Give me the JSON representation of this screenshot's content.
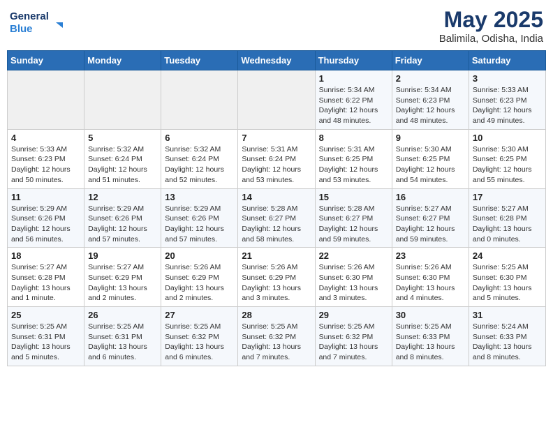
{
  "header": {
    "logo_line1": "General",
    "logo_line2": "Blue",
    "month_title": "May 2025",
    "location": "Balimila, Odisha, India"
  },
  "weekdays": [
    "Sunday",
    "Monday",
    "Tuesday",
    "Wednesday",
    "Thursday",
    "Friday",
    "Saturday"
  ],
  "weeks": [
    [
      {
        "day": "",
        "info": ""
      },
      {
        "day": "",
        "info": ""
      },
      {
        "day": "",
        "info": ""
      },
      {
        "day": "",
        "info": ""
      },
      {
        "day": "1",
        "info": "Sunrise: 5:34 AM\nSunset: 6:22 PM\nDaylight: 12 hours\nand 48 minutes."
      },
      {
        "day": "2",
        "info": "Sunrise: 5:34 AM\nSunset: 6:23 PM\nDaylight: 12 hours\nand 48 minutes."
      },
      {
        "day": "3",
        "info": "Sunrise: 5:33 AM\nSunset: 6:23 PM\nDaylight: 12 hours\nand 49 minutes."
      }
    ],
    [
      {
        "day": "4",
        "info": "Sunrise: 5:33 AM\nSunset: 6:23 PM\nDaylight: 12 hours\nand 50 minutes."
      },
      {
        "day": "5",
        "info": "Sunrise: 5:32 AM\nSunset: 6:24 PM\nDaylight: 12 hours\nand 51 minutes."
      },
      {
        "day": "6",
        "info": "Sunrise: 5:32 AM\nSunset: 6:24 PM\nDaylight: 12 hours\nand 52 minutes."
      },
      {
        "day": "7",
        "info": "Sunrise: 5:31 AM\nSunset: 6:24 PM\nDaylight: 12 hours\nand 53 minutes."
      },
      {
        "day": "8",
        "info": "Sunrise: 5:31 AM\nSunset: 6:25 PM\nDaylight: 12 hours\nand 53 minutes."
      },
      {
        "day": "9",
        "info": "Sunrise: 5:30 AM\nSunset: 6:25 PM\nDaylight: 12 hours\nand 54 minutes."
      },
      {
        "day": "10",
        "info": "Sunrise: 5:30 AM\nSunset: 6:25 PM\nDaylight: 12 hours\nand 55 minutes."
      }
    ],
    [
      {
        "day": "11",
        "info": "Sunrise: 5:29 AM\nSunset: 6:26 PM\nDaylight: 12 hours\nand 56 minutes."
      },
      {
        "day": "12",
        "info": "Sunrise: 5:29 AM\nSunset: 6:26 PM\nDaylight: 12 hours\nand 57 minutes."
      },
      {
        "day": "13",
        "info": "Sunrise: 5:29 AM\nSunset: 6:26 PM\nDaylight: 12 hours\nand 57 minutes."
      },
      {
        "day": "14",
        "info": "Sunrise: 5:28 AM\nSunset: 6:27 PM\nDaylight: 12 hours\nand 58 minutes."
      },
      {
        "day": "15",
        "info": "Sunrise: 5:28 AM\nSunset: 6:27 PM\nDaylight: 12 hours\nand 59 minutes."
      },
      {
        "day": "16",
        "info": "Sunrise: 5:27 AM\nSunset: 6:27 PM\nDaylight: 12 hours\nand 59 minutes."
      },
      {
        "day": "17",
        "info": "Sunrise: 5:27 AM\nSunset: 6:28 PM\nDaylight: 13 hours\nand 0 minutes."
      }
    ],
    [
      {
        "day": "18",
        "info": "Sunrise: 5:27 AM\nSunset: 6:28 PM\nDaylight: 13 hours\nand 1 minute."
      },
      {
        "day": "19",
        "info": "Sunrise: 5:27 AM\nSunset: 6:29 PM\nDaylight: 13 hours\nand 2 minutes."
      },
      {
        "day": "20",
        "info": "Sunrise: 5:26 AM\nSunset: 6:29 PM\nDaylight: 13 hours\nand 2 minutes."
      },
      {
        "day": "21",
        "info": "Sunrise: 5:26 AM\nSunset: 6:29 PM\nDaylight: 13 hours\nand 3 minutes."
      },
      {
        "day": "22",
        "info": "Sunrise: 5:26 AM\nSunset: 6:30 PM\nDaylight: 13 hours\nand 3 minutes."
      },
      {
        "day": "23",
        "info": "Sunrise: 5:26 AM\nSunset: 6:30 PM\nDaylight: 13 hours\nand 4 minutes."
      },
      {
        "day": "24",
        "info": "Sunrise: 5:25 AM\nSunset: 6:30 PM\nDaylight: 13 hours\nand 5 minutes."
      }
    ],
    [
      {
        "day": "25",
        "info": "Sunrise: 5:25 AM\nSunset: 6:31 PM\nDaylight: 13 hours\nand 5 minutes."
      },
      {
        "day": "26",
        "info": "Sunrise: 5:25 AM\nSunset: 6:31 PM\nDaylight: 13 hours\nand 6 minutes."
      },
      {
        "day": "27",
        "info": "Sunrise: 5:25 AM\nSunset: 6:32 PM\nDaylight: 13 hours\nand 6 minutes."
      },
      {
        "day": "28",
        "info": "Sunrise: 5:25 AM\nSunset: 6:32 PM\nDaylight: 13 hours\nand 7 minutes."
      },
      {
        "day": "29",
        "info": "Sunrise: 5:25 AM\nSunset: 6:32 PM\nDaylight: 13 hours\nand 7 minutes."
      },
      {
        "day": "30",
        "info": "Sunrise: 5:25 AM\nSunset: 6:33 PM\nDaylight: 13 hours\nand 8 minutes."
      },
      {
        "day": "31",
        "info": "Sunrise: 5:24 AM\nSunset: 6:33 PM\nDaylight: 13 hours\nand 8 minutes."
      }
    ]
  ]
}
